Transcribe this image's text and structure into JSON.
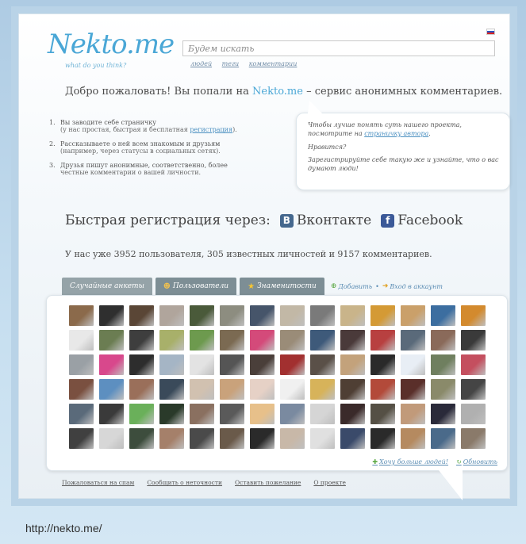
{
  "header": {
    "logo_text": "Nekto.me",
    "logo_tagline": "what do you think?",
    "search_placeholder": "Будем искать",
    "search_links": [
      "людей",
      "теги",
      "комментарии"
    ]
  },
  "welcome": {
    "prefix": "Добро пожаловать! Вы попали на ",
    "site": "Nekto.me",
    "suffix": " – сервис анонимных комментариев."
  },
  "steps": [
    {
      "num": "1.",
      "text": "Вы заводите себе страничку",
      "sub_prefix": "(у нас простая, быстрая и бесплатная ",
      "sub_link": "регистрация",
      "sub_suffix": ")."
    },
    {
      "num": "2.",
      "text": "Рассказываете о ней всем знакомым и друзьям",
      "sub_prefix": "(например, через статусы в социальных сетях).",
      "sub_link": "",
      "sub_suffix": ""
    },
    {
      "num": "3.",
      "text": "Друзья пишут анонимные, соответственно, более",
      "sub_prefix": "честные комментарии о вашей личности.",
      "sub_link": "",
      "sub_suffix": ""
    }
  ],
  "bubble": {
    "line1_prefix": "Чтобы лучше понять суть нашего проекта, посмотрите на ",
    "line1_link": "страничку автора",
    "line1_suffix": ".",
    "line2": "Нравится?",
    "line3": "Зарегистрируйте себе такую же и узнайте, что о вас думают люди!"
  },
  "quick_reg": {
    "label": "Быстрая регистрация через:",
    "vk_label": "Вконтакте",
    "vk_icon": "B",
    "fb_label": "Facebook",
    "fb_icon": "f"
  },
  "stats": "У нас уже 3952 пользователя, 305 известных личностей и 9157 комментариев.",
  "tabs": [
    {
      "label": "Случайные анкеты",
      "icon": ""
    },
    {
      "label": "Пользователи",
      "icon": "☻"
    },
    {
      "label": "Знаменитости",
      "icon": "★"
    }
  ],
  "tab_links": {
    "add": "Добавить",
    "add_icon": "⊕",
    "sep": "•",
    "login": "Вход в аккаунт",
    "login_icon": "➜"
  },
  "grid_actions": {
    "more": "Хочу больше людей!",
    "more_icon": "✚",
    "refresh": "Обновить",
    "refresh_icon": "↻"
  },
  "footer_links": [
    "Пожаловаться на спам",
    "Сообщить о неточности",
    "Оставить пожелание",
    "О проекте"
  ],
  "caption": "http://nekto.me/",
  "colors": {
    "accent": "#4aa7d6",
    "vk": "#45688e",
    "fb": "#3b5998",
    "tab": "#7d8e95"
  },
  "avatars": [
    "#8b6a4b",
    "#2f2f2f",
    "#5a4636",
    "#b0a59c",
    "#4a5a3a",
    "#8d8d80",
    "#46556a",
    "#c2b8a6",
    "#7a7a7a",
    "#c9b48a",
    "#d49a35",
    "#caa06a",
    "#3c6ea0",
    "#d38a2e",
    "#e8e8e8",
    "#6b7d52",
    "#3e3e3e",
    "#a8b06a",
    "#6d9a4e",
    "#7b6a52",
    "#d44a7a",
    "#9a8c78",
    "#3e5a7a",
    "#4a3a3a",
    "#b84040",
    "#5a6a7a",
    "#8a6a5a",
    "#3a3a3a",
    "#9aa0a5",
    "#d8488c",
    "#2d2d2d",
    "#a5b5c5",
    "#e3e3e3",
    "#555555",
    "#4a3f3a",
    "#a23030",
    "#5a5048",
    "#c3a27b",
    "#2a2a2a",
    "#e8eef5",
    "#6f7f5f",
    "#c44f5f",
    "#7a5040",
    "#5d8fc0",
    "#9a6f5a",
    "#3a4a5a",
    "#d1c1b0",
    "#c9a27b",
    "#e6d1c6",
    "#f0f0f0",
    "#d7b35a",
    "#4f3f34",
    "#b34a3a",
    "#5a2f2a",
    "#8a8a6a",
    "#454545",
    "#5a6a7a",
    "#3a3a3a",
    "#6ab05a",
    "#2a3a2a",
    "#8a7060",
    "#5a5a5a",
    "#e7c08a",
    "#7a8aa0",
    "#d5d5d5",
    "#3a2a2a",
    "#555045",
    "#c19a7a",
    "#2a2a3a",
    "#b0b0b0",
    "#404040",
    "#d7d7d7",
    "#3d4d3d",
    "#a5806a",
    "#4a4a4a",
    "#6a5a4a",
    "#2a2a2a",
    "#c8b8a8",
    "#e0e0e0",
    "#3a4a6a",
    "#2a2a2a",
    "#b58a60",
    "#4a6a8a",
    "#8a7a6a"
  ]
}
